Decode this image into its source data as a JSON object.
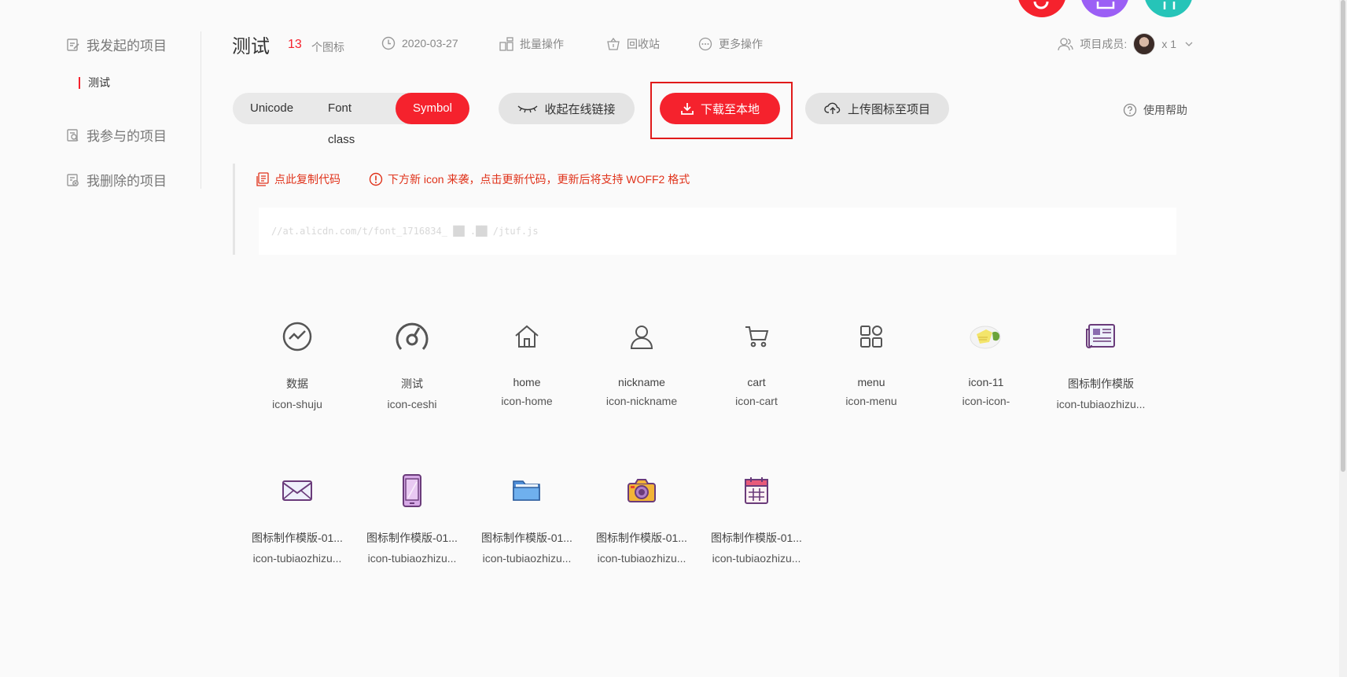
{
  "sidebar": {
    "my_projects": "我发起的项目",
    "current_project": "测试",
    "joined_projects": "我参与的项目",
    "deleted_projects": "我删除的项目"
  },
  "header": {
    "title": "测试",
    "icon_count": "13",
    "icon_count_unit": "个图标",
    "date": "2020-03-27",
    "batch_ops": "批量操作",
    "recycle_bin": "回收站",
    "more_ops": "更多操作",
    "members_label": "项目成员:",
    "members_count": "x 1"
  },
  "toolbar": {
    "tabs": [
      "Unicode",
      "Font class",
      "Symbol"
    ],
    "active_tab": "Symbol",
    "collapse_link": "收起在线链接",
    "download": "下载至本地",
    "upload": "上传图标至项目",
    "help": "使用帮助"
  },
  "code": {
    "copy": "点此复制代码",
    "notice": "下方新 icon 来袭，点击更新代码，更新后将支持 WOFF2 格式",
    "url": "//at.alicdn.com/t/font_1716834_ ██ .██ /jtuf.js"
  },
  "icons": [
    {
      "name": "数据",
      "code": "icon-shuju",
      "icon": "trend-circle-icon"
    },
    {
      "name": "测试",
      "code": "icon-ceshi",
      "icon": "gauge-icon"
    },
    {
      "name": "home",
      "code": "icon-home",
      "icon": "home-icon"
    },
    {
      "name": "nickname",
      "code": "icon-nickname",
      "icon": "user-icon"
    },
    {
      "name": "cart",
      "code": "icon-cart",
      "icon": "cart-icon"
    },
    {
      "name": "menu",
      "code": "icon-menu",
      "icon": "grid-menu-icon"
    },
    {
      "name": "icon-11",
      "code": "icon-icon-",
      "icon": "plate-food-icon"
    },
    {
      "name": "图标制作模版",
      "code": "icon-tubiaozhizu...",
      "icon": "newspaper-icon"
    },
    {
      "name": "图标制作模版-01...",
      "code": "icon-tubiaozhizu...",
      "icon": "envelope-icon"
    },
    {
      "name": "图标制作模版-01...",
      "code": "icon-tubiaozhizu...",
      "icon": "phone-icon"
    },
    {
      "name": "图标制作模版-01...",
      "code": "icon-tubiaozhizu...",
      "icon": "folder-icon"
    },
    {
      "name": "图标制作模版-01...",
      "code": "icon-tubiaozhizu...",
      "icon": "camera-icon"
    },
    {
      "name": "图标制作模版-01...",
      "code": "icon-tubiaozhizu...",
      "icon": "calendar-icon"
    }
  ],
  "colors": {
    "accent": "#f5222d",
    "purple": "#9b5ff5",
    "teal": "#26c4b8"
  }
}
